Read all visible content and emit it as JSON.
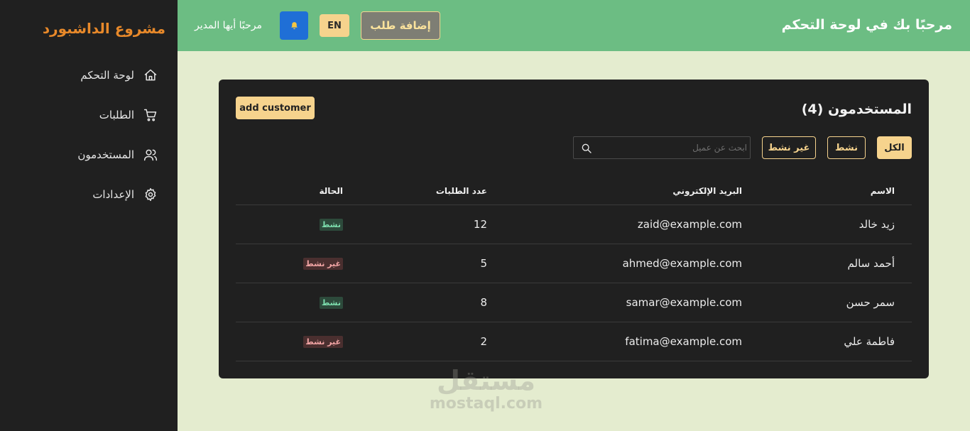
{
  "sidebar": {
    "brand": "مشروع الداشبورد",
    "items": [
      {
        "label": "لوحة التحكم",
        "icon": "home-icon"
      },
      {
        "label": "الطلبات",
        "icon": "cart-icon"
      },
      {
        "label": "المستخدمون",
        "icon": "users-icon"
      },
      {
        "label": "الإعدادات",
        "icon": "gear-icon"
      }
    ]
  },
  "header": {
    "title": "مرحبًا بك في لوحة التحكم",
    "add_order_label": "إضافة طلب",
    "lang_label": "EN",
    "bell_icon": "bell-icon",
    "greeting": "مرحبًا أيها المدير"
  },
  "users_card": {
    "title": "المستخدمون (4)",
    "add_customer_label": "add customer",
    "filters": {
      "all": "الكل",
      "active": "نشط",
      "inactive": "غير نشط"
    },
    "search": {
      "placeholder": "ابحث عن عميل",
      "value": ""
    },
    "columns": {
      "name": "الاسم",
      "email": "البريد الإلكتروني",
      "orders": "عدد الطلبات",
      "status": "الحالة"
    },
    "rows": [
      {
        "name": "زيد خالد",
        "email": "zaid@example.com",
        "orders": "12",
        "status": "نشط",
        "status_type": "active"
      },
      {
        "name": "أحمد سالم",
        "email": "ahmed@example.com",
        "orders": "5",
        "status": "غير نشط",
        "status_type": "inactive"
      },
      {
        "name": "سمر حسن",
        "email": "samar@example.com",
        "orders": "8",
        "status": "نشط",
        "status_type": "active"
      },
      {
        "name": "فاطمة علي",
        "email": "fatima@example.com",
        "orders": "2",
        "status": "غير نشط",
        "status_type": "inactive"
      }
    ]
  },
  "watermark": {
    "arabic": "مستقل",
    "latin": "mostaql.com"
  },
  "colors": {
    "sidebar_bg": "#202020",
    "header_bg": "#6cbd83",
    "page_bg": "#e4eccf",
    "accent": "#f6d38d",
    "brand": "#e8892a",
    "bell_bg": "#1f6fd6"
  }
}
